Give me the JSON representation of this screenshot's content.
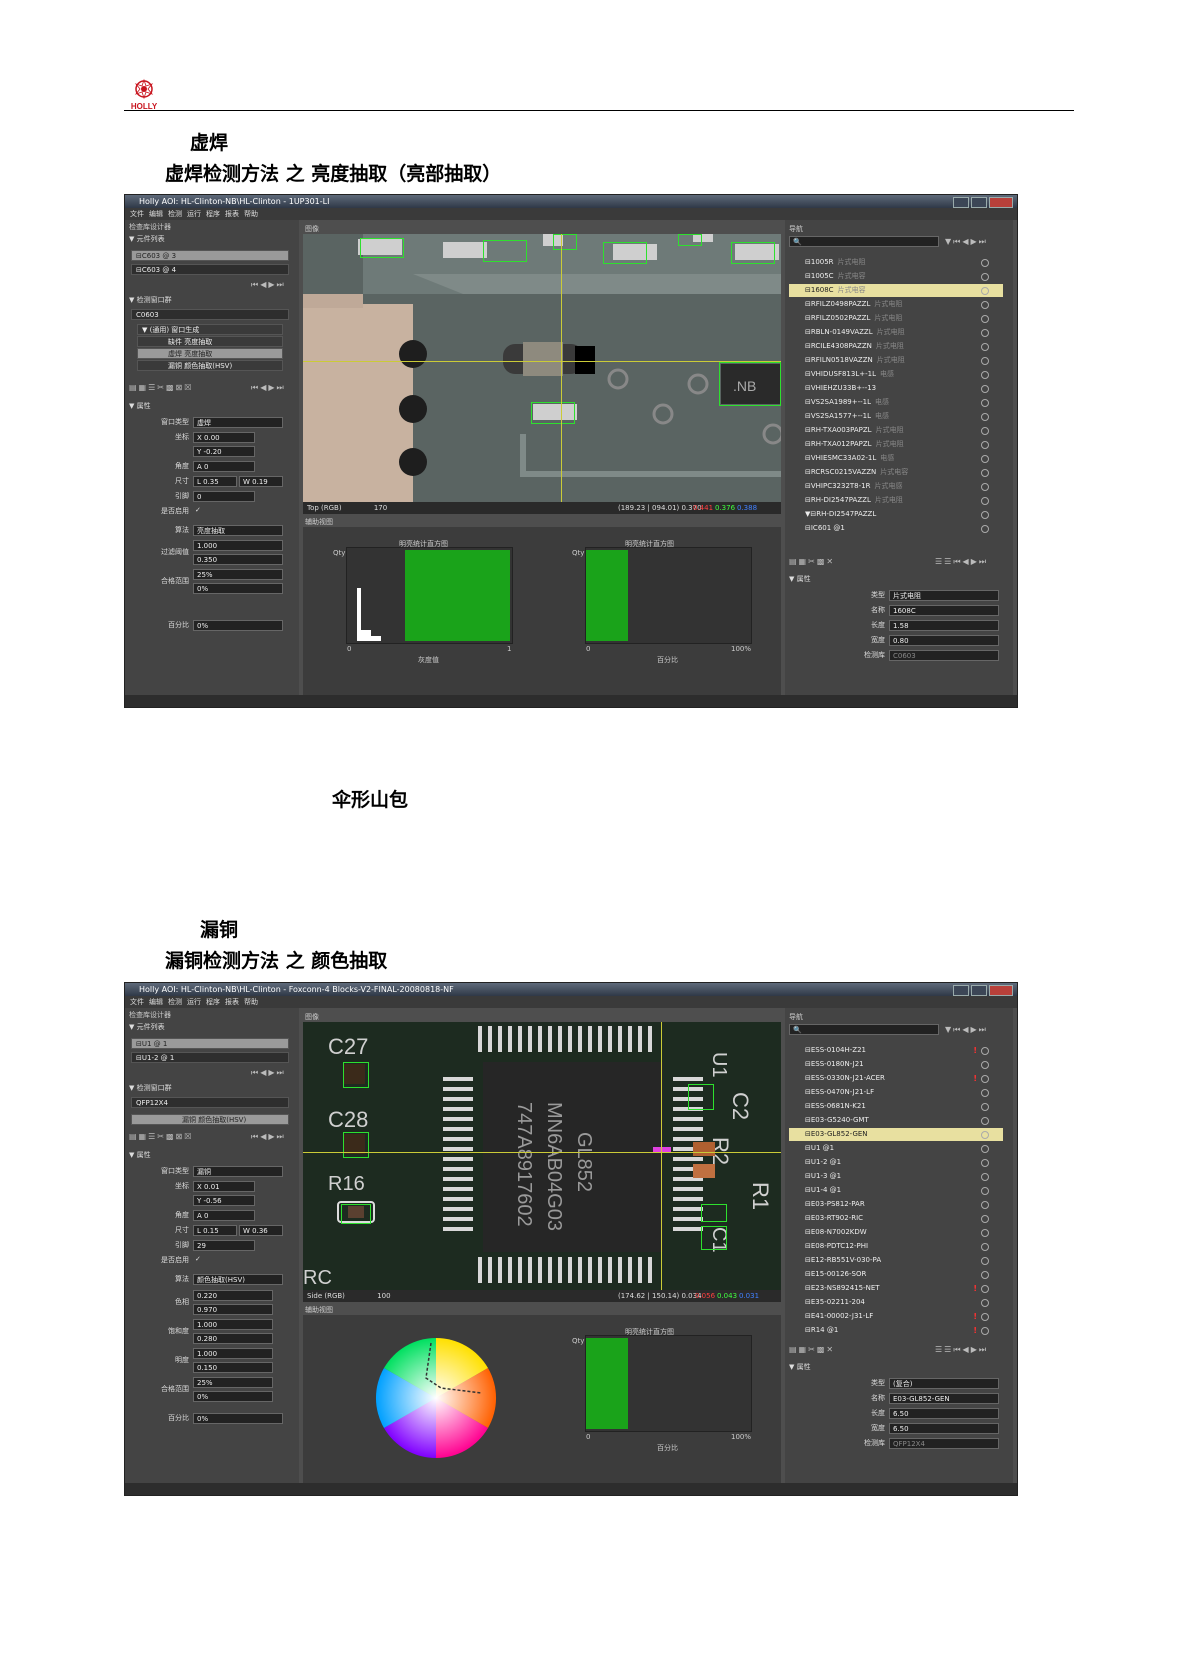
{
  "header": {
    "logo_text": "HOLLY"
  },
  "section1": {
    "title": "虚焊",
    "subtitle": "虚焊检测方法 之 亮度抽取（亮部抽取）",
    "window_title": "Holly AOI: HL-Clinton-NB\\HL-Clinton - 1UP301-LI",
    "menu": [
      "文件",
      "编辑",
      "检测",
      "运行",
      "程序",
      "报表",
      "帮助"
    ],
    "left_title": "检查库设计器",
    "comp_list_title": "▼ 元件列表",
    "comp_items": [
      "⊟C603 @ 3",
      "⊟C603 @ 4"
    ],
    "window_group_title": "▼ 检测窗口群",
    "window_group_value": "C0603",
    "tree_items": [
      "▼ (通用) 窗口生成",
      "缺件 亮度抽取",
      "虚焊 亮度抽取",
      "漏铜 颜色抽取(HSV)"
    ],
    "prop_title": "▼ 属性",
    "props": {
      "type_label": "窗口类型",
      "type_value": "虚焊",
      "coord_label": "坐标",
      "x": "X 0.00",
      "y": "Y -0.20",
      "angle_label": "角度",
      "angle": "A 0",
      "size_label": "尺寸",
      "l": "L 0.35",
      "w": "W 0.19",
      "ref_label": "引脚",
      "ref": "0",
      "enable_label": "是否启用",
      "enable": "✓"
    },
    "algo_label": "算法",
    "algo_value": "亮度抽取",
    "filter_label": "过滤阈值",
    "filter_hi": "1.000",
    "filter_lo": "0.350",
    "pass_label": "合格范围",
    "pass_hi": "25%",
    "pass_lo": "0%",
    "pct_label": "百分比",
    "pct_value": "0%",
    "image_title": "图像",
    "image_mode": "Top (RGB)",
    "image_zoom": "170",
    "coords": "(189.23 | 094.01) 0.370",
    "rgb_r": "0.441",
    "rgb_g": "0.376",
    "rgb_b": "0.388",
    "aux_title": "辅助视图",
    "hist1_title": "明亮统计直方图",
    "hist1_y": "Qty",
    "hist1_x0": "0",
    "hist1_x1": "1",
    "hist1_xlabel": "灰度值",
    "hist2_title": "明亮统计直方图",
    "hist2_y": "Qty",
    "hist2_x0": "0",
    "hist2_x1": "100%",
    "hist2_xlabel": "百分比",
    "nav_title": "导航",
    "nav_items": [
      {
        "name": "⊟1005R",
        "kind": "片式电阻"
      },
      {
        "name": "⊟1005C",
        "kind": "片式电容"
      },
      {
        "name": "⊟1608C",
        "kind": "片式电容",
        "sel": true
      },
      {
        "name": "⊟RFILZ0498PAZZL",
        "kind": "片式电阻"
      },
      {
        "name": "⊟RFILZ0502PAZZL",
        "kind": "片式电阻"
      },
      {
        "name": "⊟RBLN-0149VAZZL",
        "kind": "片式电阻"
      },
      {
        "name": "⊟RCILE4308PAZZN",
        "kind": "片式电阻"
      },
      {
        "name": "⊟RFILN0518VAZZN",
        "kind": "片式电阻"
      },
      {
        "name": "⊟VHIDUSF813L+-1L",
        "kind": "电感"
      },
      {
        "name": "⊟VHIEHZU33B+--13",
        "kind": ""
      },
      {
        "name": "⊟VS2SA1989+--1L",
        "kind": "电感"
      },
      {
        "name": "⊟VS2SA1577+--1L",
        "kind": "电感"
      },
      {
        "name": "⊟RH-TXA003PAPZL",
        "kind": "片式电阻"
      },
      {
        "name": "⊟RH-TXA012PAPZL",
        "kind": "片式电阻"
      },
      {
        "name": "⊟VHIESMC33A02-1L",
        "kind": "电感"
      },
      {
        "name": "⊟RCRSC0215VAZZN",
        "kind": "片式电容"
      },
      {
        "name": "⊟VHIPC3232T8-1R",
        "kind": "片式电感"
      },
      {
        "name": "⊟RH-DI2547PAZZL",
        "kind": "片式电阻"
      },
      {
        "name": "▼⊟RH-DI2547PAZZL",
        "kind": ""
      },
      {
        "name": "⊟IC601 @1",
        "kind": ""
      }
    ],
    "nprop_title": "▼ 属性",
    "nprops": {
      "type_label": "类型",
      "type_value": "片式电阻",
      "name_label": "名称",
      "name_value": "1608C",
      "len_label": "长度",
      "len_value": "1.58",
      "wid_label": "宽度",
      "wid_value": "0.80",
      "lib_label": "检测库",
      "lib_value": "C0603"
    }
  },
  "section_mid": {
    "title": "伞形山包"
  },
  "section2": {
    "title": "漏铜",
    "subtitle": "漏铜检测方法 之 颜色抽取",
    "window_title": "Holly AOI: HL-Clinton-NB\\HL-Clinton - Foxconn-4 Blocks-V2-FINAL-20080818-NF",
    "menu": [
      "文件",
      "编辑",
      "检测",
      "运行",
      "程序",
      "报表",
      "帮助"
    ],
    "left_title": "检查库设计器",
    "comp_list_title": "▼ 元件列表",
    "comp_items": [
      "⊟U1 @ 1",
      "⊟U1-2 @ 1"
    ],
    "window_group_title": "▼ 检测窗口群",
    "window_group_value": "QFP12X4",
    "tree_items": [
      "漏铜 颜色抽取(HSV)"
    ],
    "prop_title": "▼ 属性",
    "props": {
      "type_label": "窗口类型",
      "type_value": "漏铜",
      "coord_label": "坐标",
      "x": "X 0.01",
      "y": "Y -0.56",
      "angle_label": "角度",
      "angle": "A 0",
      "size_label": "尺寸",
      "l": "L 0.15",
      "w": "W 0.36",
      "ref_label": "引脚",
      "ref": "29",
      "enable_label": "是否启用",
      "enable": "✓"
    },
    "algo_label": "算法",
    "algo_value": "颜色抽取(HSV)",
    "hue_label": "色相",
    "hue_hi": "0.220",
    "hue_lo": "0.970",
    "sat_label": "饱和度",
    "sat_hi": "1.000",
    "sat_lo": "0.280",
    "val_label": "明度",
    "val_hi": "1.000",
    "val_lo": "0.150",
    "pass_label": "合格范围",
    "pass_hi": "25%",
    "pass_lo": "0%",
    "pct_label": "百分比",
    "pct_value": "0%",
    "image_title": "图像",
    "image_mode": "Side (RGB)",
    "image_zoom": "100",
    "coords": "(174.62 | 150.14) 0.034",
    "rgb_r": "0.056",
    "rgb_g": "0.043",
    "rgb_b": "0.031",
    "aux_title": "辅助视图",
    "hist2_title": "明亮统计直方图",
    "hist2_y": "Qty",
    "hist2_x0": "0",
    "hist2_x1": "100%",
    "hist2_xlabel": "百分比",
    "pcb_labels": {
      "c27": "C27",
      "c28": "C28",
      "r16": "R16",
      "rc": "RC",
      "c2": "C2",
      "r2": "R2",
      "r1": "R1",
      "c1": "C1",
      "u1": "U1",
      "chip1": "GL852",
      "chip2": "MN6AB04G03",
      "chip3": "747A8917602"
    },
    "nav_title": "导航",
    "nav_items": [
      {
        "name": "⊟ESS-0104H-Z21",
        "warn": true
      },
      {
        "name": "⊟ESS-0180N-J21"
      },
      {
        "name": "⊟ESS-0330N-J21-ACER",
        "warn": true
      },
      {
        "name": "⊟ESS-0470N-J21-LF"
      },
      {
        "name": "⊟ESS-0681N-K21"
      },
      {
        "name": "⊟E03-G5240-GMT"
      },
      {
        "name": "⊟E03-GL852-GEN",
        "sel": true
      },
      {
        "name": "⊟U1 @1"
      },
      {
        "name": "⊟U1-2 @1"
      },
      {
        "name": "⊟U1-3 @1"
      },
      {
        "name": "⊟U1-4 @1"
      },
      {
        "name": "⊟E03-PS812-PAR"
      },
      {
        "name": "⊟E03-RT902-RIC"
      },
      {
        "name": "⊟E08-N7002KDW"
      },
      {
        "name": "⊟E08-PDTC12-PHI"
      },
      {
        "name": "⊟E12-RB551V-030-PA"
      },
      {
        "name": "⊟E15-00126-SOR"
      },
      {
        "name": "⊟E23-NS892415-NET",
        "warn": true
      },
      {
        "name": "⊟E35-02211-204"
      },
      {
        "name": "⊟E41-00002-J31-LF",
        "warn": true
      },
      {
        "name": "⊟R14 @1",
        "warn": true
      }
    ],
    "nprop_title": "▼ 属性",
    "nprops": {
      "type_label": "类型",
      "type_value": "(复合)",
      "name_label": "名称",
      "name_value": "E03-GL852-GEN",
      "len_label": "长度",
      "len_value": "6.50",
      "wid_label": "宽度",
      "wid_value": "6.50",
      "lib_label": "检测库",
      "lib_value": "QFP12X4"
    }
  }
}
